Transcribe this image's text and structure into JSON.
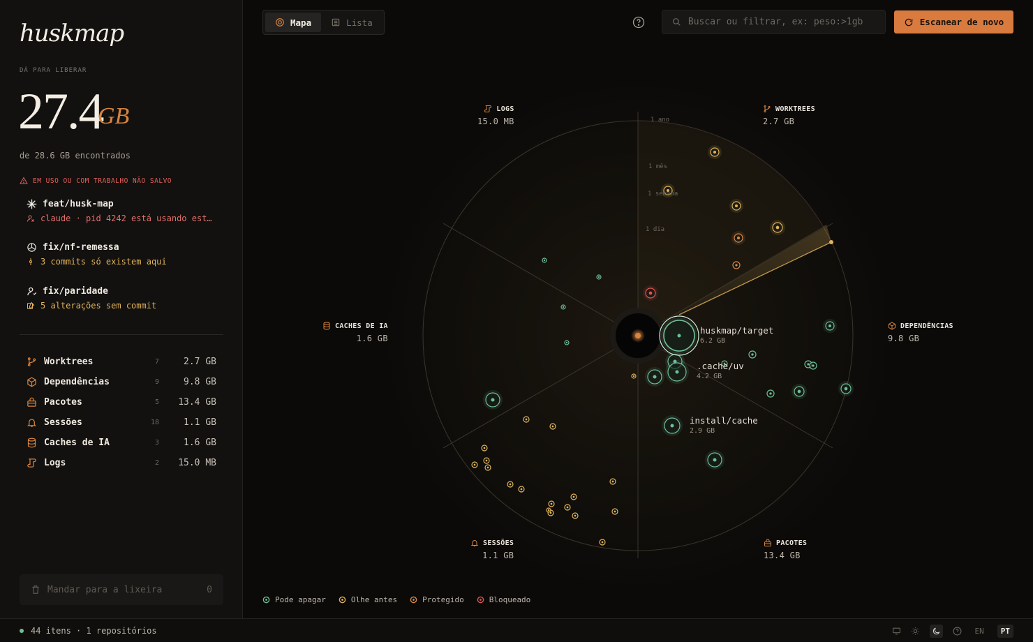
{
  "app": {
    "logo": "huskmap"
  },
  "summary": {
    "label": "DÁ PARA LIBERAR",
    "amount": "27.4",
    "unit": "GB",
    "found": "de 28.6 GB encontrados"
  },
  "warnings": {
    "heading": "EM USO OU COM TRABALHO NÃO SALVO",
    "items": [
      {
        "title": "feat/husk-map",
        "icon": "asterisk-icon",
        "detail": "claude · pid 4242 está usando est…",
        "detail_icon": "user-icon",
        "tone": "red"
      },
      {
        "title": "fix/nf-remessa",
        "icon": "openai-icon",
        "detail": "3 commits só existem aqui",
        "detail_icon": "commit-icon",
        "tone": "gold"
      },
      {
        "title": "fix/paridade",
        "icon": "user-icon",
        "detail": "5 alterações sem commit",
        "detail_icon": "edit-icon",
        "tone": "gold"
      }
    ]
  },
  "categories": [
    {
      "name": "Worktrees",
      "count": "7",
      "size": "2.7 GB",
      "icon": "branch-icon"
    },
    {
      "name": "Dependências",
      "count": "9",
      "size": "9.8 GB",
      "icon": "box-icon"
    },
    {
      "name": "Pacotes",
      "count": "5",
      "size": "13.4 GB",
      "icon": "package-icon"
    },
    {
      "name": "Sessões",
      "count": "18",
      "size": "1.1 GB",
      "icon": "bell-icon"
    },
    {
      "name": "Caches de IA",
      "count": "3",
      "size": "1.6 GB",
      "icon": "database-icon"
    },
    {
      "name": "Logs",
      "count": "2",
      "size": "15.0 MB",
      "icon": "scroll-icon"
    }
  ],
  "trash": {
    "label": "Mandar para a lixeira",
    "count": "0"
  },
  "toolbar": {
    "tabs": [
      {
        "label": "Mapa",
        "active": true
      },
      {
        "label": "Lista",
        "active": false
      }
    ],
    "search_placeholder": "Buscar ou filtrar, ex: peso:>1gb",
    "rescan_label": "Escanear de novo"
  },
  "map": {
    "sectors": [
      {
        "name": "LOGS",
        "size": "15.0 MB",
        "icon": "scroll-icon"
      },
      {
        "name": "WORKTREES",
        "size": "2.7 GB",
        "icon": "branch-icon"
      },
      {
        "name": "CACHES DE IA",
        "size": "1.6 GB",
        "icon": "database-icon"
      },
      {
        "name": "DEPENDÊNCIAS",
        "size": "9.8 GB",
        "icon": "box-icon"
      },
      {
        "name": "SESSÕES",
        "size": "1.1 GB",
        "icon": "bell-icon"
      },
      {
        "name": "PACOTES",
        "size": "13.4 GB",
        "icon": "package-icon"
      }
    ],
    "rings": [
      "1 ano",
      "1 mês",
      "1 semana",
      "1 dia"
    ],
    "highlighted": [
      {
        "name": "huskmap/target",
        "size": "6.2 GB"
      },
      {
        "name": ".cache/uv",
        "size": "4.2 GB"
      },
      {
        "name": "install/cache",
        "size": "2.9 GB"
      }
    ]
  },
  "legend": [
    {
      "label": "Pode apagar",
      "color": "#6fbf95"
    },
    {
      "label": "Olhe antes",
      "color": "#e2b35c"
    },
    {
      "label": "Protegido",
      "color": "#d98a4a"
    },
    {
      "label": "Bloqueado",
      "color": "#e0564f"
    }
  ],
  "status": {
    "items": "44 itens · 1 repositórios",
    "languages": [
      {
        "code": "EN",
        "active": false
      },
      {
        "code": "PT",
        "active": true
      }
    ]
  }
}
